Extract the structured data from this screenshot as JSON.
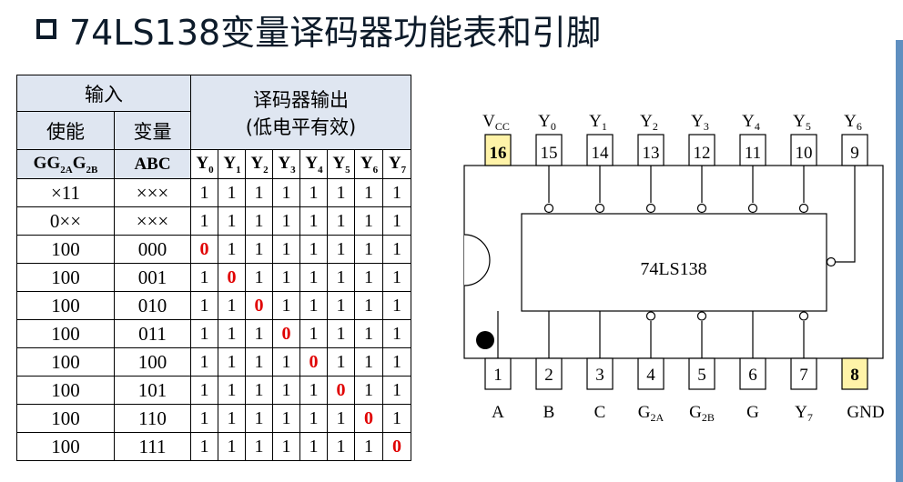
{
  "title": "74LS138变量译码器功能表和引脚",
  "table": {
    "group_input": "输入",
    "group_output_line1": "译码器输出",
    "group_output_line2": "(低电平有效)",
    "col_enable": "使能",
    "col_variable": "变量",
    "sym_enable": [
      "G",
      "G",
      "2A",
      "G",
      "2B"
    ],
    "sym_variable": "ABC",
    "output_headers": [
      {
        "name": "Y",
        "sub": "0"
      },
      {
        "name": "Y",
        "sub": "1"
      },
      {
        "name": "Y",
        "sub": "2"
      },
      {
        "name": "Y",
        "sub": "3"
      },
      {
        "name": "Y",
        "sub": "4"
      },
      {
        "name": "Y",
        "sub": "5"
      },
      {
        "name": "Y",
        "sub": "6"
      },
      {
        "name": "Y",
        "sub": "7"
      }
    ],
    "rows": [
      {
        "enable": "×11",
        "variable": "×××",
        "outputs": [
          "1",
          "1",
          "1",
          "1",
          "1",
          "1",
          "1",
          "1"
        ]
      },
      {
        "enable": "0××",
        "variable": "×××",
        "outputs": [
          "1",
          "1",
          "1",
          "1",
          "1",
          "1",
          "1",
          "1"
        ]
      },
      {
        "enable": "100",
        "variable": "000",
        "outputs": [
          "0",
          "1",
          "1",
          "1",
          "1",
          "1",
          "1",
          "1"
        ]
      },
      {
        "enable": "100",
        "variable": "001",
        "outputs": [
          "1",
          "0",
          "1",
          "1",
          "1",
          "1",
          "1",
          "1"
        ]
      },
      {
        "enable": "100",
        "variable": "010",
        "outputs": [
          "1",
          "1",
          "0",
          "1",
          "1",
          "1",
          "1",
          "1"
        ]
      },
      {
        "enable": "100",
        "variable": "011",
        "outputs": [
          "1",
          "1",
          "1",
          "0",
          "1",
          "1",
          "1",
          "1"
        ]
      },
      {
        "enable": "100",
        "variable": "100",
        "outputs": [
          "1",
          "1",
          "1",
          "1",
          "0",
          "1",
          "1",
          "1"
        ]
      },
      {
        "enable": "100",
        "variable": "101",
        "outputs": [
          "1",
          "1",
          "1",
          "1",
          "1",
          "0",
          "1",
          "1"
        ]
      },
      {
        "enable": "100",
        "variable": "110",
        "outputs": [
          "1",
          "1",
          "1",
          "1",
          "1",
          "1",
          "0",
          "1"
        ]
      },
      {
        "enable": "100",
        "variable": "111",
        "outputs": [
          "1",
          "1",
          "1",
          "1",
          "1",
          "1",
          "1",
          "0"
        ]
      }
    ]
  },
  "chip": {
    "label": "74LS138",
    "top_pins": [
      {
        "number": "16",
        "signal": "V",
        "signal_sub": "CC",
        "highlight": true
      },
      {
        "number": "15",
        "signal": "Y",
        "signal_sub": "0",
        "highlight": false
      },
      {
        "number": "14",
        "signal": "Y",
        "signal_sub": "1",
        "highlight": false
      },
      {
        "number": "13",
        "signal": "Y",
        "signal_sub": "2",
        "highlight": false
      },
      {
        "number": "12",
        "signal": "Y",
        "signal_sub": "3",
        "highlight": false
      },
      {
        "number": "11",
        "signal": "Y",
        "signal_sub": "4",
        "highlight": false
      },
      {
        "number": "10",
        "signal": "Y",
        "signal_sub": "5",
        "highlight": false
      },
      {
        "number": "9",
        "signal": "Y",
        "signal_sub": "6",
        "highlight": false
      }
    ],
    "bottom_pins": [
      {
        "number": "1",
        "signal": "A",
        "signal_sub": "",
        "highlight": false
      },
      {
        "number": "2",
        "signal": "B",
        "signal_sub": "",
        "highlight": false
      },
      {
        "number": "3",
        "signal": "C",
        "signal_sub": "",
        "highlight": false
      },
      {
        "number": "4",
        "signal": "G",
        "signal_sub": "2A",
        "highlight": false
      },
      {
        "number": "5",
        "signal": "G",
        "signal_sub": "2B",
        "highlight": false
      },
      {
        "number": "6",
        "signal": "G",
        "signal_sub": "",
        "highlight": false
      },
      {
        "number": "7",
        "signal": "Y",
        "signal_sub": "7",
        "highlight": false
      },
      {
        "number": "8",
        "signal": "GND",
        "signal_sub": "",
        "highlight": true
      }
    ],
    "highlight_color": "#fff3a8"
  }
}
